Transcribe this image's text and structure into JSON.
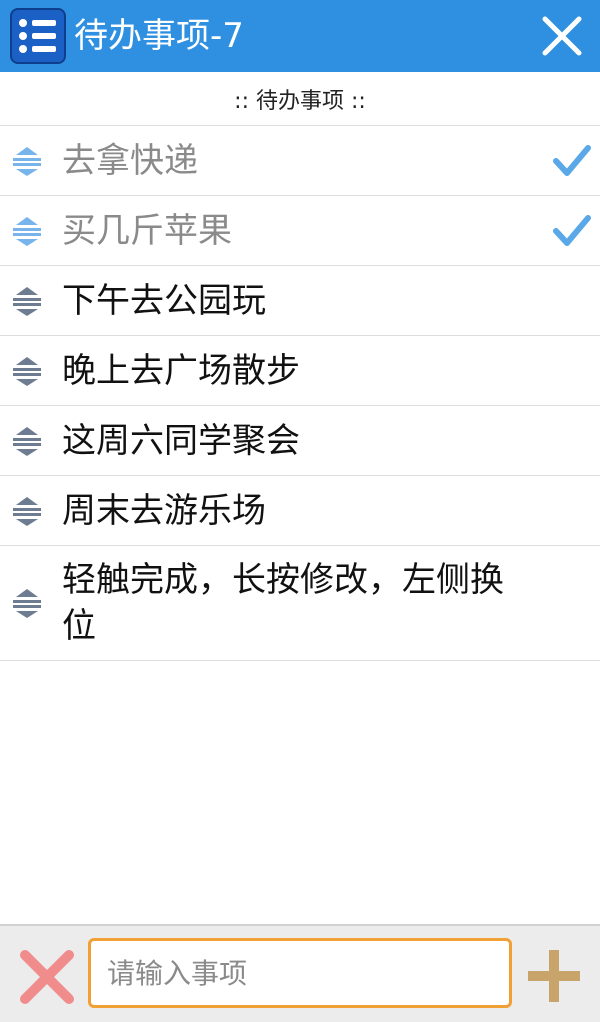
{
  "header": {
    "title": "待办事项-7",
    "app_icon": "list-icon",
    "close_icon": "close-icon",
    "bar_color": "#2f8fe1"
  },
  "section": {
    "label": ":: 待办事项 ::"
  },
  "items": [
    {
      "text": "去拿快递",
      "done": true
    },
    {
      "text": "买几斤苹果",
      "done": true
    },
    {
      "text": "下午去公园玩",
      "done": false
    },
    {
      "text": "晚上去广场散步",
      "done": false
    },
    {
      "text": "这周六同学聚会",
      "done": false
    },
    {
      "text": "周末去游乐场",
      "done": false
    },
    {
      "text": "轻触完成，长按修改，左侧换位",
      "done": false
    }
  ],
  "footer": {
    "input_placeholder": "请输入事项",
    "clear_icon": "clear-x-icon",
    "add_icon": "plus-icon",
    "input_border_color": "#f0a035"
  },
  "colors": {
    "check": "#5aa8e8",
    "handle_done": "#78b4ec",
    "handle_pending": "#6e7c92",
    "clear": "#f08c8c",
    "add": "#c8a46a"
  }
}
